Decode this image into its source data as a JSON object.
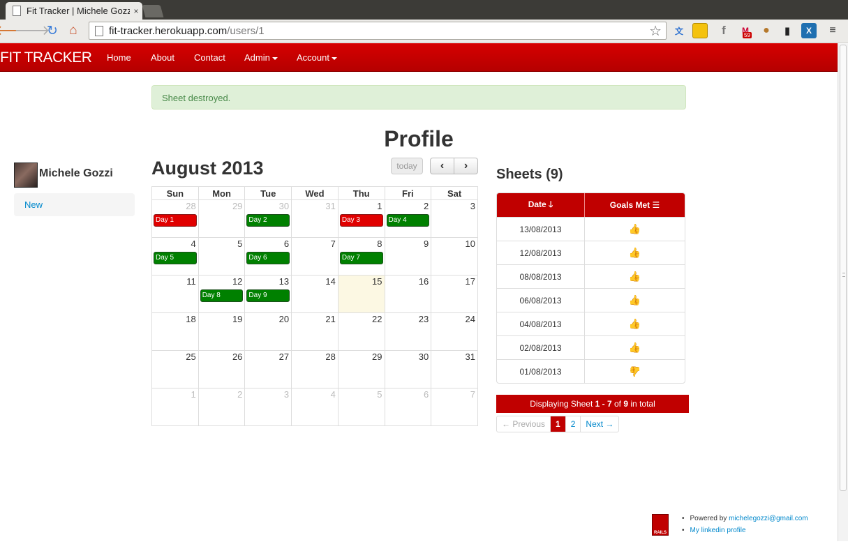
{
  "browser": {
    "tab_title": "Fit Tracker | Michele Gozzi",
    "tab_close": "×",
    "url_host": "fit-tracker.herokuapp.com",
    "url_path": "/users/1",
    "gmail_badge": "59",
    "icons": [
      "back-icon",
      "forward-icon",
      "reload-icon",
      "home-icon",
      "star-icon",
      "translate-icon",
      "folder-icon",
      "facebook-icon",
      "gmail-icon",
      "cookie-icon",
      "extension-icon",
      "x-icon",
      "menu-icon"
    ]
  },
  "navbar": {
    "brand": "FIT TRACKER",
    "items": [
      "Home",
      "About",
      "Contact",
      "Admin",
      "Account"
    ],
    "color": "#c00000"
  },
  "flash": {
    "message": "Sheet destroyed."
  },
  "page": {
    "title": "Profile"
  },
  "sidebar": {
    "user_name": "Michele Gozzi",
    "nav_item": "New"
  },
  "calendar": {
    "title": "August 2013",
    "today_label": "today",
    "prev_icon": "chevron-left-icon",
    "next_icon": "chevron-right-icon",
    "weekdays": [
      "Sun",
      "Mon",
      "Tue",
      "Wed",
      "Thu",
      "Fri",
      "Sat"
    ],
    "weeks": [
      [
        {
          "day": "28",
          "other": true,
          "event": null
        },
        {
          "day": "29",
          "other": true,
          "event": null
        },
        {
          "day": "30",
          "other": true,
          "event": null
        },
        {
          "day": "31",
          "other": true,
          "event": null
        },
        {
          "day": "1",
          "other": false,
          "event": null
        },
        {
          "day": "2",
          "other": false,
          "event": null
        },
        {
          "day": "3",
          "other": false,
          "event": null
        }
      ],
      [
        {
          "day": "4",
          "other": false,
          "event": null
        },
        {
          "day": "5",
          "other": false,
          "event": null
        },
        {
          "day": "6",
          "other": false,
          "event": null
        },
        {
          "day": "7",
          "other": false,
          "event": null
        },
        {
          "day": "8",
          "other": false,
          "event": null
        },
        {
          "day": "9",
          "other": false,
          "event": null
        },
        {
          "day": "10",
          "other": false,
          "event": null
        }
      ],
      [
        {
          "day": "11",
          "other": false,
          "event": null
        },
        {
          "day": "12",
          "other": false,
          "event": null
        },
        {
          "day": "13",
          "other": false,
          "event": null
        },
        {
          "day": "14",
          "other": false,
          "event": null
        },
        {
          "day": "15",
          "other": false,
          "today": true,
          "event": null
        },
        {
          "day": "16",
          "other": false,
          "event": null
        },
        {
          "day": "17",
          "other": false,
          "event": null
        }
      ],
      [
        {
          "day": "18",
          "other": false,
          "event": null
        },
        {
          "day": "19",
          "other": false,
          "event": null
        },
        {
          "day": "20",
          "other": false,
          "event": null
        },
        {
          "day": "21",
          "other": false,
          "event": null
        },
        {
          "day": "22",
          "other": false,
          "event": null
        },
        {
          "day": "23",
          "other": false,
          "event": null
        },
        {
          "day": "24",
          "other": false,
          "event": null
        }
      ],
      [
        {
          "day": "25",
          "other": false,
          "event": null
        },
        {
          "day": "26",
          "other": false,
          "event": null
        },
        {
          "day": "27",
          "other": false,
          "event": null
        },
        {
          "day": "28",
          "other": false,
          "event": null
        },
        {
          "day": "29",
          "other": false,
          "event": null
        },
        {
          "day": "30",
          "other": false,
          "event": null
        },
        {
          "day": "31",
          "other": false,
          "event": null
        }
      ],
      [
        {
          "day": "1",
          "other": true,
          "event": null
        },
        {
          "day": "2",
          "other": true,
          "event": null
        },
        {
          "day": "3",
          "other": true,
          "event": null
        },
        {
          "day": "4",
          "other": true,
          "event": null
        },
        {
          "day": "5",
          "other": true,
          "event": null
        },
        {
          "day": "6",
          "other": true,
          "event": null
        },
        {
          "day": "7",
          "other": true,
          "event": null
        }
      ]
    ],
    "events": [
      {
        "week": 0,
        "weekday": 0,
        "label": "Day 1",
        "color": "red"
      },
      {
        "week": 0,
        "weekday": 2,
        "label": "Day 2",
        "color": "green"
      },
      {
        "week": 0,
        "weekday": 4,
        "label": "Day 3",
        "color": "red"
      },
      {
        "week": 0,
        "weekday": 5,
        "label": "Day 4",
        "color": "green"
      },
      {
        "week": 1,
        "weekday": 0,
        "label": "Day 5",
        "color": "green"
      },
      {
        "week": 1,
        "weekday": 2,
        "label": "Day 6",
        "color": "green"
      },
      {
        "week": 1,
        "weekday": 4,
        "label": "Day 7",
        "color": "green"
      },
      {
        "week": 2,
        "weekday": 1,
        "label": "Day 8",
        "color": "green"
      },
      {
        "week": 2,
        "weekday": 2,
        "label": "Day 9",
        "color": "green"
      }
    ]
  },
  "sheets": {
    "title": "Sheets (9)",
    "columns": [
      "Date",
      "Goals Met"
    ],
    "date_sort_icon": "arrow-down-icon",
    "goals_icon": "list-icon",
    "rows": [
      {
        "date": "13/08/2013",
        "goal": "up"
      },
      {
        "date": "12/08/2013",
        "goal": "up"
      },
      {
        "date": "08/08/2013",
        "goal": "up"
      },
      {
        "date": "06/08/2013",
        "goal": "up"
      },
      {
        "date": "04/08/2013",
        "goal": "up"
      },
      {
        "date": "02/08/2013",
        "goal": "up"
      },
      {
        "date": "01/08/2013",
        "goal": "down"
      }
    ],
    "summary": {
      "prefix": "Displaying Sheet",
      "range": "1 - 7",
      "of": "of",
      "total": "9",
      "suffix": "in total"
    },
    "pagination": {
      "prev": "← Previous",
      "pages": [
        "1",
        "2"
      ],
      "active": "1",
      "next": "Next →"
    }
  },
  "footer": {
    "powered_by": "Powered by",
    "email": "michelegozzi@gmail.com",
    "linkedin": "My linkedin profile",
    "logo_text": "RAILS"
  }
}
